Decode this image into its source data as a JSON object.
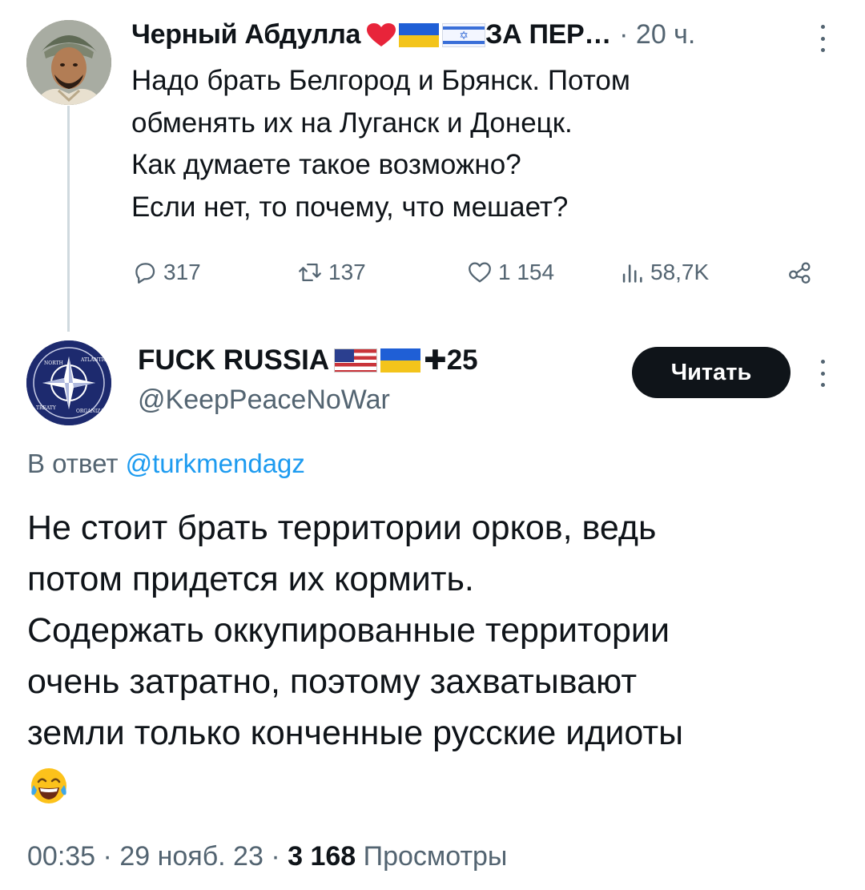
{
  "tweet1": {
    "author_name": "Черный Абдулла",
    "author_suffix": "ЗА ПЕР…",
    "time_sep": "·",
    "time": "20 ч.",
    "lines": [
      "Надо брать Белгород и Брянск. Потом",
      "обменять их на Луганск и Донецк.",
      "Как думаете такое возможно?",
      "Если нет, то почему, что мешает?"
    ],
    "stats": {
      "replies": "317",
      "retweets": "137",
      "likes": "1 154",
      "views": "58,7K"
    },
    "icons": [
      "heart-emoji",
      "ukraine-flag",
      "israel-flag",
      "comment-icon",
      "retweet-icon",
      "like-icon",
      "views-icon",
      "share-icon",
      "more-icon"
    ]
  },
  "tweet2": {
    "author_name": "FUCK RUSSIA",
    "author_suffix": "25",
    "handle": "@KeepPeaceNoWar",
    "follow_label": "Читать",
    "reply_prefix": "В ответ",
    "reply_mention": "@turkmendagz",
    "lines": [
      "Не стоит брать территории орков, ведь",
      "потом придется их кормить.",
      "Содержать оккупированные территории",
      "очень затратно, поэтому захватывают",
      "земли только конченные русские идиоты"
    ],
    "emoji": "tears-of-joy-emoji",
    "meta": {
      "time": "00:35",
      "date": "29 нояб. 23",
      "sep": "·",
      "views_count": "3 168",
      "views_label": "Просмотры"
    },
    "icons": [
      "usa-flag",
      "ukraine-flag",
      "cross-icon",
      "nato-logo",
      "more-icon"
    ]
  },
  "colors": {
    "text": "#0f1419",
    "secondary": "#536471",
    "link": "#1d9bf0",
    "thread_line": "#cfd9de",
    "button_bg": "#0f1419"
  }
}
